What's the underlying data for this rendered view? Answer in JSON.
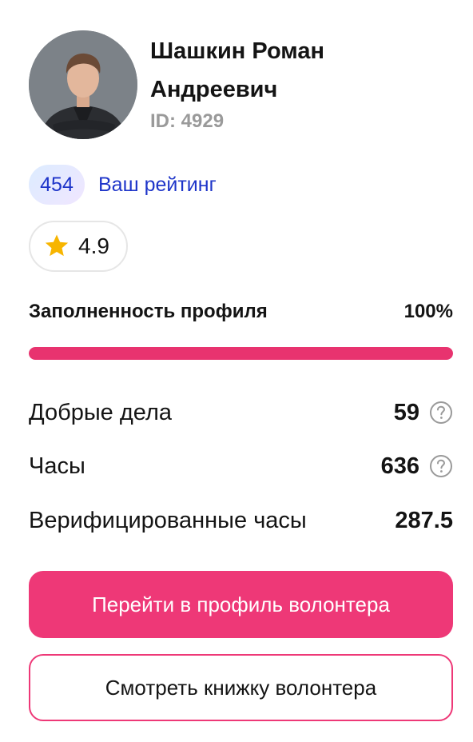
{
  "profile": {
    "name": "Шашкин Роман Андреевич",
    "id_label": "ID: 4929"
  },
  "rating": {
    "value": "454",
    "label": "Ваш рейтинг"
  },
  "stars": {
    "icon": "star-icon",
    "value": "4.9",
    "color": "#f7b500"
  },
  "completeness": {
    "label": "Заполненность профиля",
    "value_text": "100%",
    "fraction": 1.0
  },
  "stats": [
    {
      "label": "Добрые дела",
      "value": "59",
      "help_icon": "question-circle-icon"
    },
    {
      "label": "Часы",
      "value": "636",
      "help_icon": "question-circle-icon"
    },
    {
      "label": "Верифицированные часы",
      "value": "287.5"
    }
  ],
  "actions": {
    "primary_label": "Перейти в профиль волонтера",
    "secondary_label": "Смотреть книжку волонтера"
  },
  "colors": {
    "accent": "#ee3877",
    "rating_text": "#1e35c9",
    "muted_text": "#9a9a9a"
  }
}
